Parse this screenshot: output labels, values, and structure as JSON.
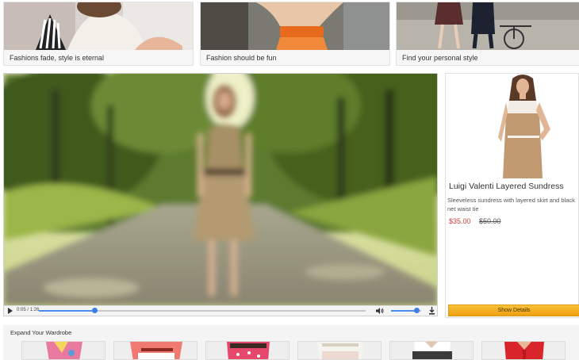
{
  "promos": [
    {
      "caption": "Fashions fade, style is eternal"
    },
    {
      "caption": "Fashion should be fun"
    },
    {
      "caption": "Find your personal style"
    }
  ],
  "video": {
    "time": "0:05 / 1:26",
    "progress": 0.17,
    "volume": 0.85,
    "icons": {
      "play": "play-icon",
      "volume": "volume-icon",
      "download": "download-icon"
    }
  },
  "product": {
    "name": "Luigi Valenti Layered Sundress",
    "description": "Sleeveless sundress with layered skirt and black net waist tie",
    "price": "$35.00",
    "old_price": "$50.00",
    "button_label": "Show Details"
  },
  "wardrobe": {
    "title": "Expand Your Wardrobe",
    "items": [
      "item-1",
      "item-2",
      "item-3",
      "item-4",
      "item-5",
      "item-6"
    ]
  },
  "colors": {
    "accent": "#4a8cf0",
    "price": "#d0413e",
    "button": "#f2a91c"
  }
}
